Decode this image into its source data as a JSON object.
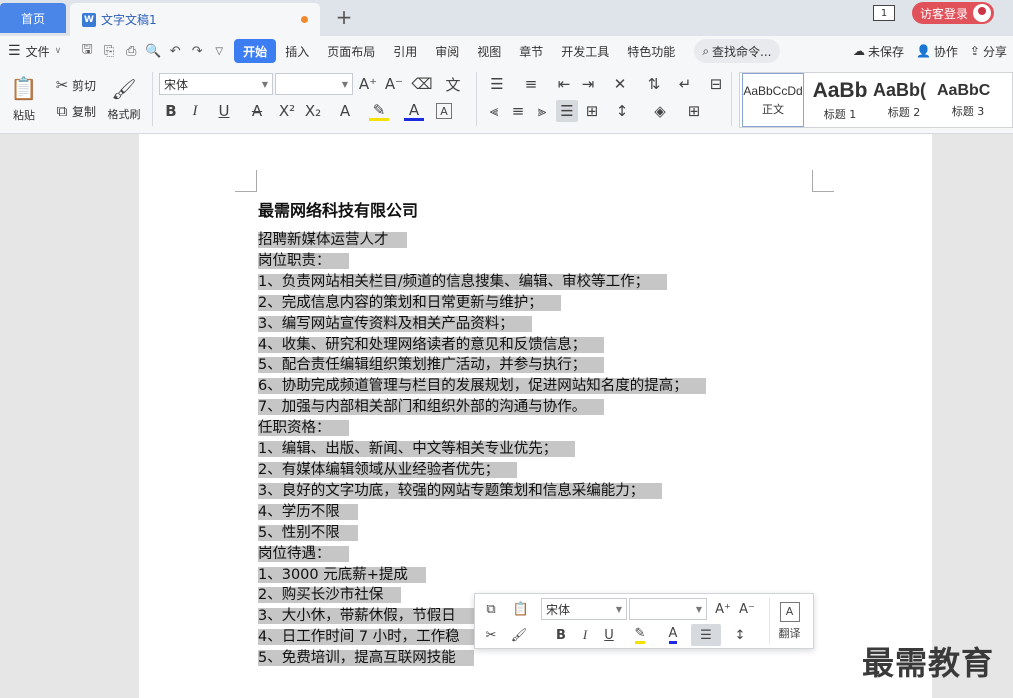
{
  "tabs": {
    "home": "首页",
    "doc_icon": "W",
    "doc_title": "文字文稿1",
    "add": "+"
  },
  "window": {
    "page_indicator": "1",
    "login": "访客登录"
  },
  "menu": {
    "file": "文件",
    "items": [
      "开始",
      "插入",
      "页面布局",
      "引用",
      "审阅",
      "视图",
      "章节",
      "开发工具",
      "特色功能"
    ],
    "search": "查找命令...",
    "unsaved": "未保存",
    "collab": "协作",
    "share": "分享"
  },
  "ribbon": {
    "paste": "粘贴",
    "cut": "剪切",
    "copy": "复制",
    "format_painter": "格式刷",
    "font_name": "宋体",
    "font_size": "",
    "styles": [
      {
        "preview": "AaBbCcDd",
        "label": "正文"
      },
      {
        "preview": "AaBb",
        "label": "标题 1"
      },
      {
        "preview": "AaBb(",
        "label": "标题 2"
      },
      {
        "preview": "AaBbC",
        "label": "标题 3"
      }
    ]
  },
  "document": {
    "title": "最需网络科技有限公司",
    "lines": [
      "招聘新媒体运营人才",
      "岗位职责：",
      "1、负责网站相关栏目/频道的信息搜集、编辑、审校等工作；",
      "2、完成信息内容的策划和日常更新与维护；",
      "3、编写网站宣传资料及相关产品资料；",
      "4、收集、研究和处理网络读者的意见和反馈信息；",
      "5、配合责任编辑组织策划推广活动，并参与执行；",
      "6、协助完成频道管理与栏目的发展规划，促进网站知名度的提高；",
      "7、加强与内部相关部门和组织外部的沟通与协作。",
      "任职资格：",
      "1、编辑、出版、新闻、中文等相关专业优先；",
      "2、有媒体编辑领域从业经验者优先；",
      "3、良好的文字功底，较强的网站专题策划和信息采编能力；",
      "4、学历不限",
      "5、性别不限",
      "岗位待遇：",
      "1、3000 元底薪+提成",
      "2、购买长沙市社保",
      "3、大小休，带薪休假，节假日",
      "4、日工作时间 7 小时，工作稳",
      "5、免费培训，提高互联网技能"
    ]
  },
  "float_toolbar": {
    "font_name": "宋体",
    "font_size": "",
    "translate": "翻译"
  },
  "watermark": "最需教育"
}
